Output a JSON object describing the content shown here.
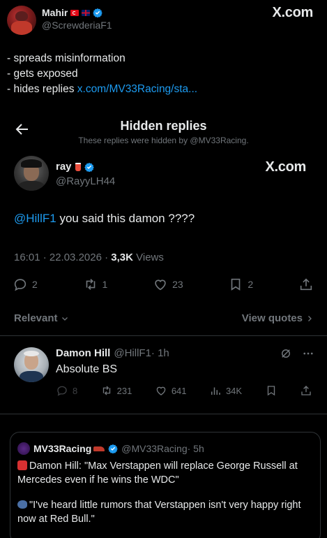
{
  "top_tweet": {
    "author_name": "Mahir",
    "author_handle": "@ScrewderiaF1",
    "logo_text": "X.com",
    "lines": [
      "- spreads misinformation",
      "- gets exposed",
      "- hides replies "
    ],
    "link_text": "x.com/MV33Racing/sta..."
  },
  "hidden_replies": {
    "title": "Hidden replies",
    "subtitle": "These replies were hidden by @MV33Racing."
  },
  "reply_tweet": {
    "author_name": "ray",
    "author_handle": "@RayyLH44",
    "logo_text": "X.com",
    "mention": "@HillF1",
    "text": " you said this damon ????",
    "timestamp": "16:01 · 22.03.2026 · ",
    "views_count": "3,3K",
    "views_label": " Views",
    "replies": "2",
    "reposts": "1",
    "likes": "23",
    "bookmarks": "2"
  },
  "sort_bar": {
    "relevant_label": "Relevant",
    "view_quotes_label": "View quotes"
  },
  "damon_reply": {
    "author_name": "Damon Hill",
    "author_handle": "@HillF1",
    "time": " · 1h",
    "text": "Absolute BS",
    "replies": "8",
    "reposts": "231",
    "likes": "641",
    "views": "34K"
  },
  "quoted_tweet": {
    "author_name": "MV33Racing",
    "author_handle": "@MV33Racing",
    "time": " · 5h",
    "paragraph1": "Damon Hill: \"Max Verstappen will replace George Russell at Mercedes even if he wins the WDC\"",
    "paragraph2": "\"I've heard little rumors that Verstappen isn't very happy right now at Red Bull.\""
  },
  "colors": {
    "background": "#000000",
    "text": "#e7e9ea",
    "muted": "#71767b",
    "link": "#1d9bf0",
    "divider": "#2f3336"
  },
  "icons": [
    "verified-badge-icon",
    "back-arrow-icon",
    "reply-icon",
    "repost-icon",
    "like-icon",
    "bookmark-icon",
    "share-icon",
    "views-icon",
    "chevron-down-icon",
    "chevron-right-icon",
    "grok-icon",
    "more-icon"
  ]
}
